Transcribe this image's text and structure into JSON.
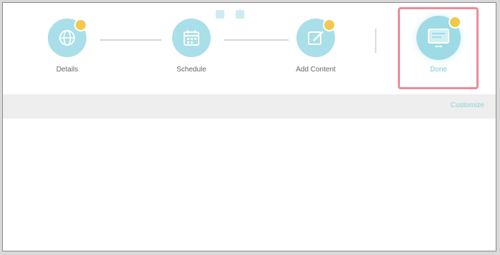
{
  "pager": {
    "pages": 2
  },
  "steps": [
    {
      "label": "Details",
      "icon": "globe-icon",
      "has_badge": true
    },
    {
      "label": "Schedule",
      "icon": "calendar-icon",
      "has_badge": false
    },
    {
      "label": "Add Content",
      "icon": "edit-icon",
      "has_badge": true
    },
    {
      "label": "Done",
      "icon": "monitor-icon",
      "has_badge": true,
      "active": true
    }
  ],
  "toolbar": {
    "link_label": "Customize"
  },
  "colors": {
    "icon_fill": "#a8dfe8",
    "badge": "#f2c94c",
    "active_border": "#f08a99",
    "link": "#8fd0dc",
    "toolbar_bg": "#eeeeee"
  }
}
